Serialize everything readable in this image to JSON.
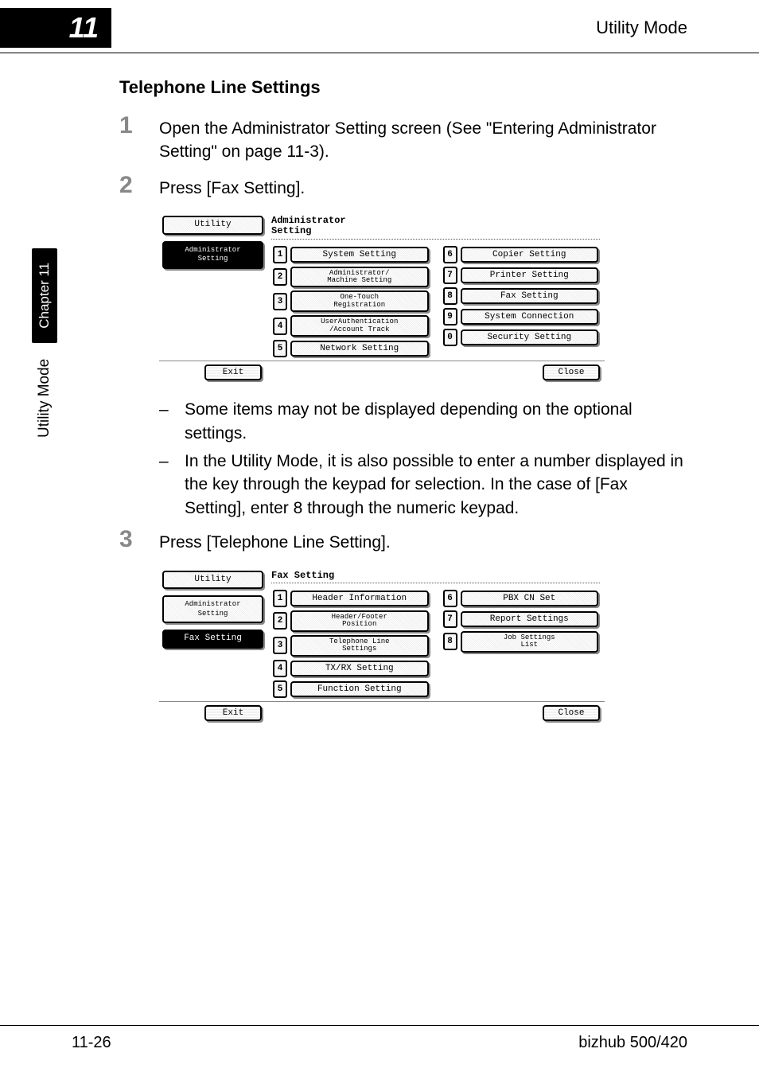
{
  "header": {
    "chapter_num": "11",
    "mode": "Utility Mode"
  },
  "section": {
    "title": "Telephone Line Settings"
  },
  "steps": {
    "s1": {
      "num": "1",
      "text": "Open the Administrator Setting screen (See \"Entering Administrator Setting\" on page 11-3)."
    },
    "s2": {
      "num": "2",
      "text": "Press [Fax Setting]."
    },
    "s3": {
      "num": "3",
      "text": "Press [Telephone Line Setting]."
    }
  },
  "bullets": {
    "b1": "Some items may not be displayed depending on the optional settings.",
    "b2": "In the Utility Mode, it is also possible to enter a number displayed in the key through the keypad for selection. In the case of [Fax Setting], enter 8 through the numeric keypad."
  },
  "lcd1": {
    "sidebar": {
      "utility": "Utility",
      "admin": "Administrator\nSetting"
    },
    "title": "Administrator\nSetting",
    "buttons": {
      "n1": "1",
      "b1": "System Setting",
      "n2": "2",
      "b2": "Administrator/\nMachine Setting",
      "n3": "3",
      "b3": "One-Touch\nRegistration",
      "n4": "4",
      "b4": "UserAuthentication\n/Account Track",
      "n5": "5",
      "b5": "Network Setting",
      "n6": "6",
      "b6": "Copier Setting",
      "n7": "7",
      "b7": "Printer Setting",
      "n8": "8",
      "b8": "Fax Setting",
      "n9": "9",
      "b9": "System Connection",
      "n0": "0",
      "b0": "Security Setting"
    },
    "exit": "Exit",
    "close": "Close"
  },
  "lcd2": {
    "sidebar": {
      "utility": "Utility",
      "admin": "Administrator\nSetting",
      "fax": "Fax Setting"
    },
    "title": "Fax Setting",
    "buttons": {
      "n1": "1",
      "b1": "Header Information",
      "n2": "2",
      "b2": "Header/Footer\nPosition",
      "n3": "3",
      "b3": "Telephone Line\nSettings",
      "n4": "4",
      "b4": "TX/RX Setting",
      "n5": "5",
      "b5": "Function Setting",
      "n6": "6",
      "b6": "PBX CN Set",
      "n7": "7",
      "b7": "Report Settings",
      "n8": "8",
      "b8": "Job Settings\nList"
    },
    "exit": "Exit",
    "close": "Close"
  },
  "side": {
    "chapter": "Chapter 11",
    "utility": "Utility Mode"
  },
  "footer": {
    "left": "11-26",
    "right": "bizhub 500/420"
  }
}
